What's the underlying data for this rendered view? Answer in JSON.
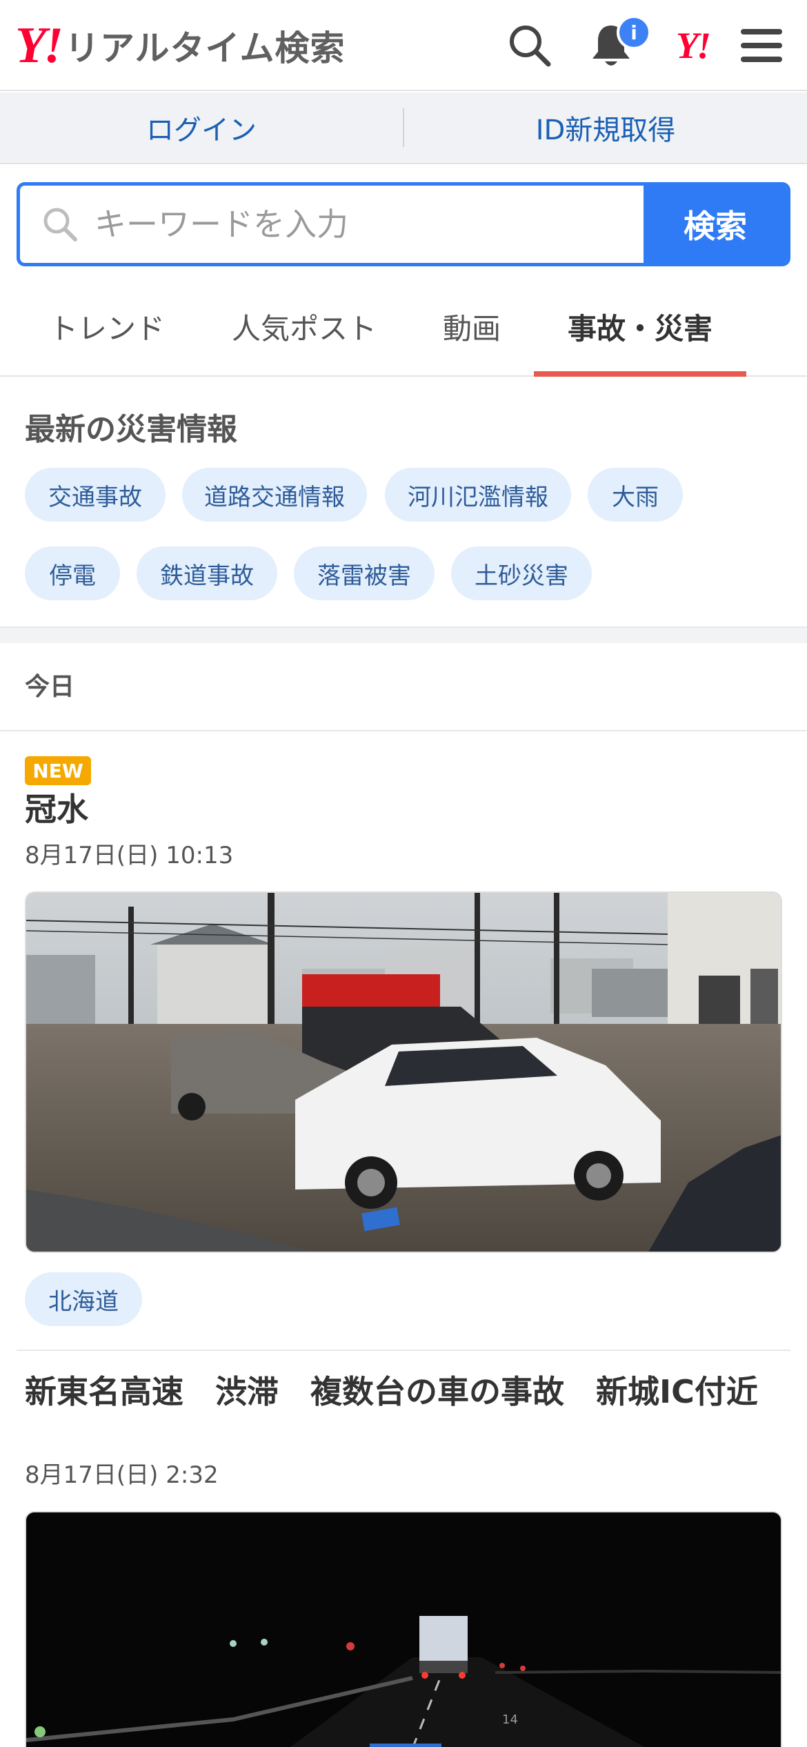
{
  "header": {
    "logo_mark": "Y!",
    "logo_text": "リアルタイム検索",
    "notification_badge": "i",
    "yahoo_link": "Y!"
  },
  "auth": {
    "login_label": "ログイン",
    "register_label": "ID新規取得"
  },
  "search": {
    "placeholder": "キーワードを入力",
    "button_label": "検索"
  },
  "tabs": [
    {
      "label": "トレンド",
      "active": false
    },
    {
      "label": "人気ポスト",
      "active": false
    },
    {
      "label": "動画",
      "active": false
    },
    {
      "label": "事故・災害",
      "active": true
    }
  ],
  "disaster_info": {
    "title": "最新の災害情報",
    "chips": [
      "交通事故",
      "道路交通情報",
      "河川氾濫情報",
      "大雨",
      "停電",
      "鉄道事故",
      "落雷被害",
      "土砂災害"
    ]
  },
  "feed": {
    "section_label": "今日",
    "items": [
      {
        "badge": "NEW",
        "title": "冠水",
        "date": "8月17日(日) 10:13",
        "image_desc": "flooded-street-with-cars",
        "tag": "北海道"
      },
      {
        "title": "新東名高速　渋滞　複数台の車の事故　新城IC付近",
        "date": "8月17日(日) 2:32",
        "image_desc": "night-highway-dashcam",
        "overlay_text": "14"
      }
    ]
  },
  "colors": {
    "brand_red": "#ff0033",
    "accent_blue": "#2f7bf5",
    "tab_indicator": "#e85a4f",
    "chip_bg": "#e3effc",
    "new_badge": "#f5a800"
  }
}
